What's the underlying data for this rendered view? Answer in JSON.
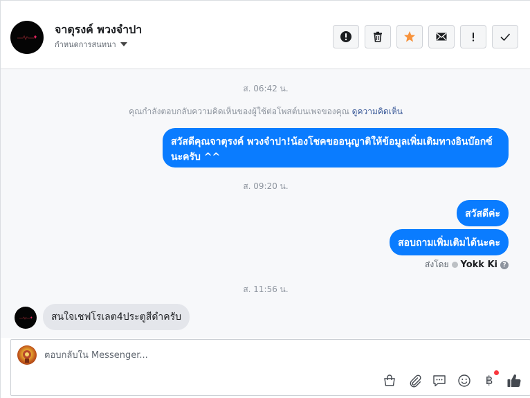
{
  "header": {
    "contact_name": "จาตุรงค์ พวงจำปา",
    "assign_label": "กำหนดการสนทนา",
    "actions": [
      {
        "name": "mark-spam",
        "icon": "exclamation-circle-icon"
      },
      {
        "name": "delete",
        "icon": "trash-icon"
      },
      {
        "name": "star",
        "icon": "star-icon"
      },
      {
        "name": "mark-unread",
        "icon": "envelope-icon"
      },
      {
        "name": "flag",
        "icon": "exclamation-icon"
      },
      {
        "name": "mark-done",
        "icon": "check-icon"
      }
    ],
    "star_color": "#f7923b"
  },
  "conversation": {
    "ts1": "ส. 06:42 น.",
    "notice_text": "คุณกำลังตอบกลับความคิดเห็นของผู้ใช้ต่อโพสต์บนเพจของคุณ",
    "notice_link": "ดูความคิดเห็น",
    "msg_out_1": "สวัสดีคุณจาตุรงค์ พวงจำปา!น้องโชคขออนุญาติให้ข้อมูลเพิ่มเติมทางอินบ๊อกซ์นะครับ ^^",
    "ts2": "ส. 09:20 น.",
    "msg_out_2": "สวัสดีค่ะ",
    "msg_out_3": "สอบถามเพิ่มเติมได้นะคะ",
    "sent_by_label": "ส่งโดย",
    "sent_by_name": "Yokk Ki",
    "ts3": "ส. 11:56 น.",
    "msg_in_1": "สนใจเชฟโรเลต4ประตูสีดำครับ",
    "bubble_color": "#0a7cff"
  },
  "composer": {
    "placeholder": "ตอบกลับใน Messenger...",
    "tools": [
      "shopping-bag-icon",
      "paperclip-icon",
      "chat-bubble-icon",
      "smiley-icon",
      "baht-icon",
      "thumbs-up-icon"
    ],
    "baht_symbol": "฿"
  }
}
